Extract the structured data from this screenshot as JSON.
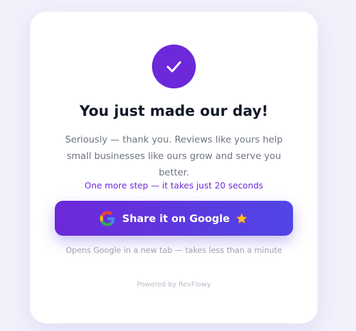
{
  "card": {
    "title": "You just made our day!",
    "subtitle": "Seriously — thank you. Reviews like yours help small businesses like ours grow and serve you better.",
    "prompt": "One more step — it takes just 20 seconds",
    "share_button": {
      "label": "Share it on Google",
      "icon": "google-icon",
      "trailing_icon": "star-icon"
    },
    "note": "Opens Google in a new tab — takes less than a minute",
    "powered_by": "Powered by RevFlowy"
  },
  "colors": {
    "background": "#f1f0fb",
    "accent": "#6d28d9",
    "button_gradient_start": "#6d28d9",
    "button_gradient_end": "#4f46e5",
    "title": "#111827",
    "muted_text": "#6b7280"
  },
  "icons": {
    "success": "check-icon"
  }
}
